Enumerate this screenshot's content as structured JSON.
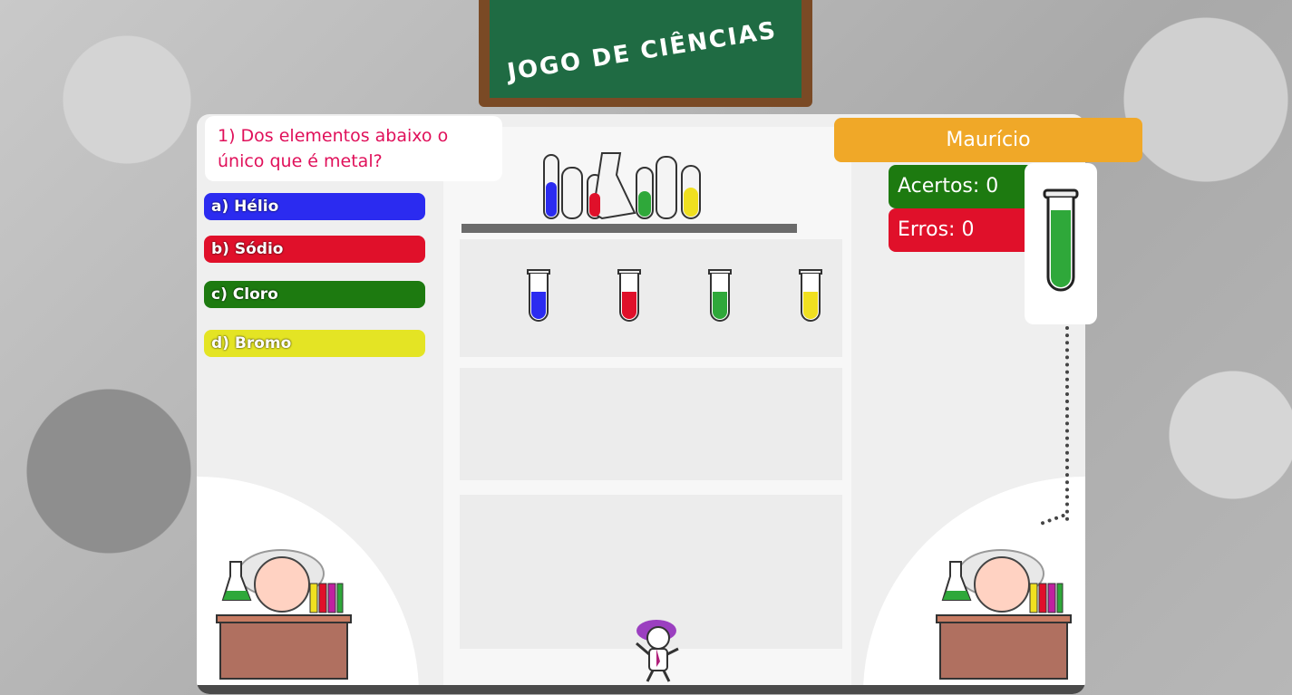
{
  "header": {
    "title": "JOGO DE CIÊNCIAS"
  },
  "question": {
    "text": "1) Dos elementos abaixo o único que é metal?"
  },
  "options": [
    {
      "label": "a) Hélio",
      "color": "#2b2bf0"
    },
    {
      "label": "b) Sódio",
      "color": "#e0102a"
    },
    {
      "label": "c) Cloro",
      "color": "#1d7a10"
    },
    {
      "label": "d) Bromo",
      "color": "#e4e424"
    }
  ],
  "player": {
    "name": "Maurício",
    "color": "#f0a828"
  },
  "score": {
    "hits_label": "Acertos: 0",
    "hits_color": "#1d7a10",
    "errors_label": "Erros: 0",
    "errors_color": "#e0102a"
  },
  "current_tube": {
    "color": "#2fa83a"
  },
  "shelf_tubes": [
    {
      "color": "#2b2bf0",
      "icon": "blue-test-tube-icon"
    },
    {
      "color": "#e0102a",
      "icon": "red-test-tube-icon"
    },
    {
      "color": "#2fa83a",
      "icon": "green-test-tube-icon"
    },
    {
      "color": "#f0e020",
      "icon": "yellow-test-tube-icon"
    }
  ]
}
